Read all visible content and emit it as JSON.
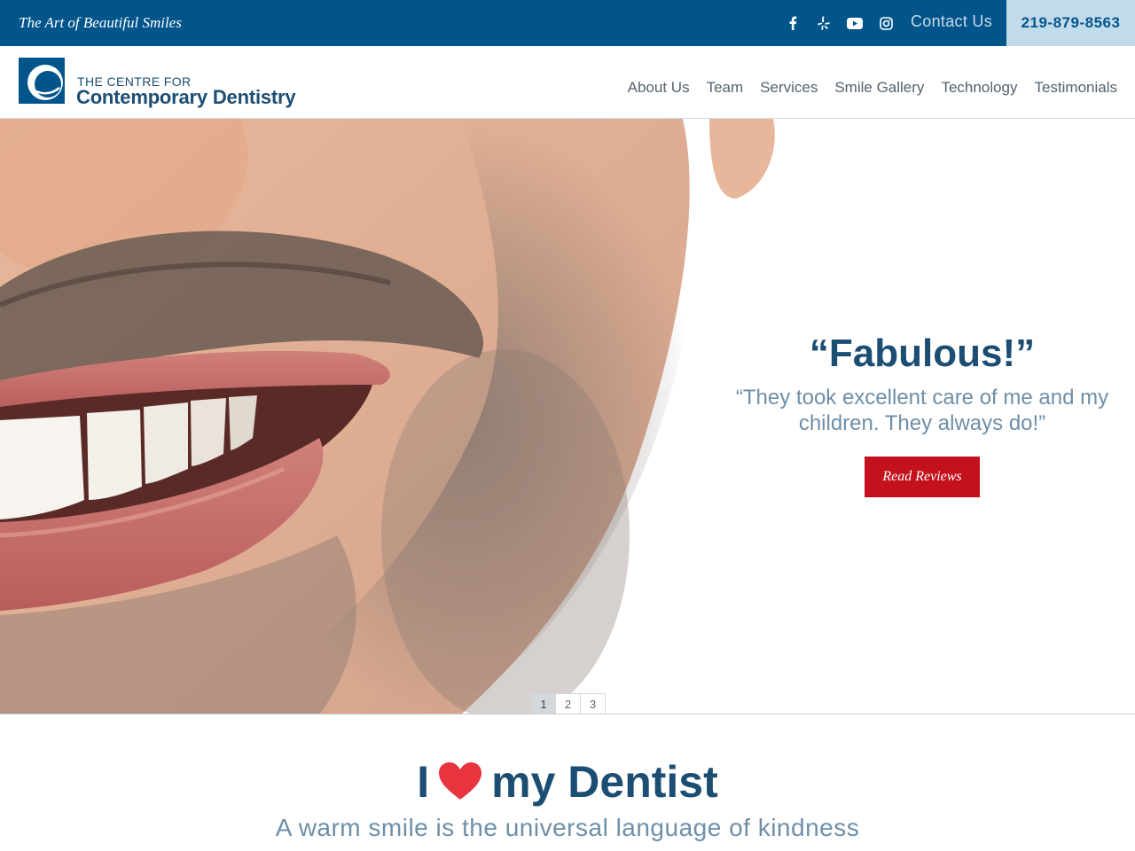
{
  "topbar": {
    "tagline": "The Art of Beautiful Smiles",
    "social_icons": [
      "facebook-icon",
      "yelp-icon",
      "youtube-icon",
      "instagram-icon"
    ],
    "contact_label": "Contact Us",
    "phone": "219-879-8563"
  },
  "logo": {
    "line1": "THE CENTRE FOR",
    "line2": "Contemporary Dentistry"
  },
  "nav": {
    "items": [
      {
        "label": "About Us"
      },
      {
        "label": "Team"
      },
      {
        "label": "Services"
      },
      {
        "label": "Smile Gallery"
      },
      {
        "label": "Technology"
      },
      {
        "label": "Testimonials"
      }
    ]
  },
  "hero": {
    "title": "“Fabulous!”",
    "quote": "“They took excellent care of me and my children. They always do!”",
    "button_label": "Read Reviews",
    "pages": [
      "1",
      "2",
      "3"
    ],
    "active_page": "1"
  },
  "section": {
    "heading_before": "I",
    "heading_after": "my Dentist",
    "subtitle": "A warm smile is the universal language of kindness"
  },
  "colors": {
    "primary_blue": "#02558b",
    "navy_text": "#1c4d73",
    "light_blue": "#c2dbeb",
    "accent_red": "#c3111d",
    "heart_red": "#e8343f"
  }
}
